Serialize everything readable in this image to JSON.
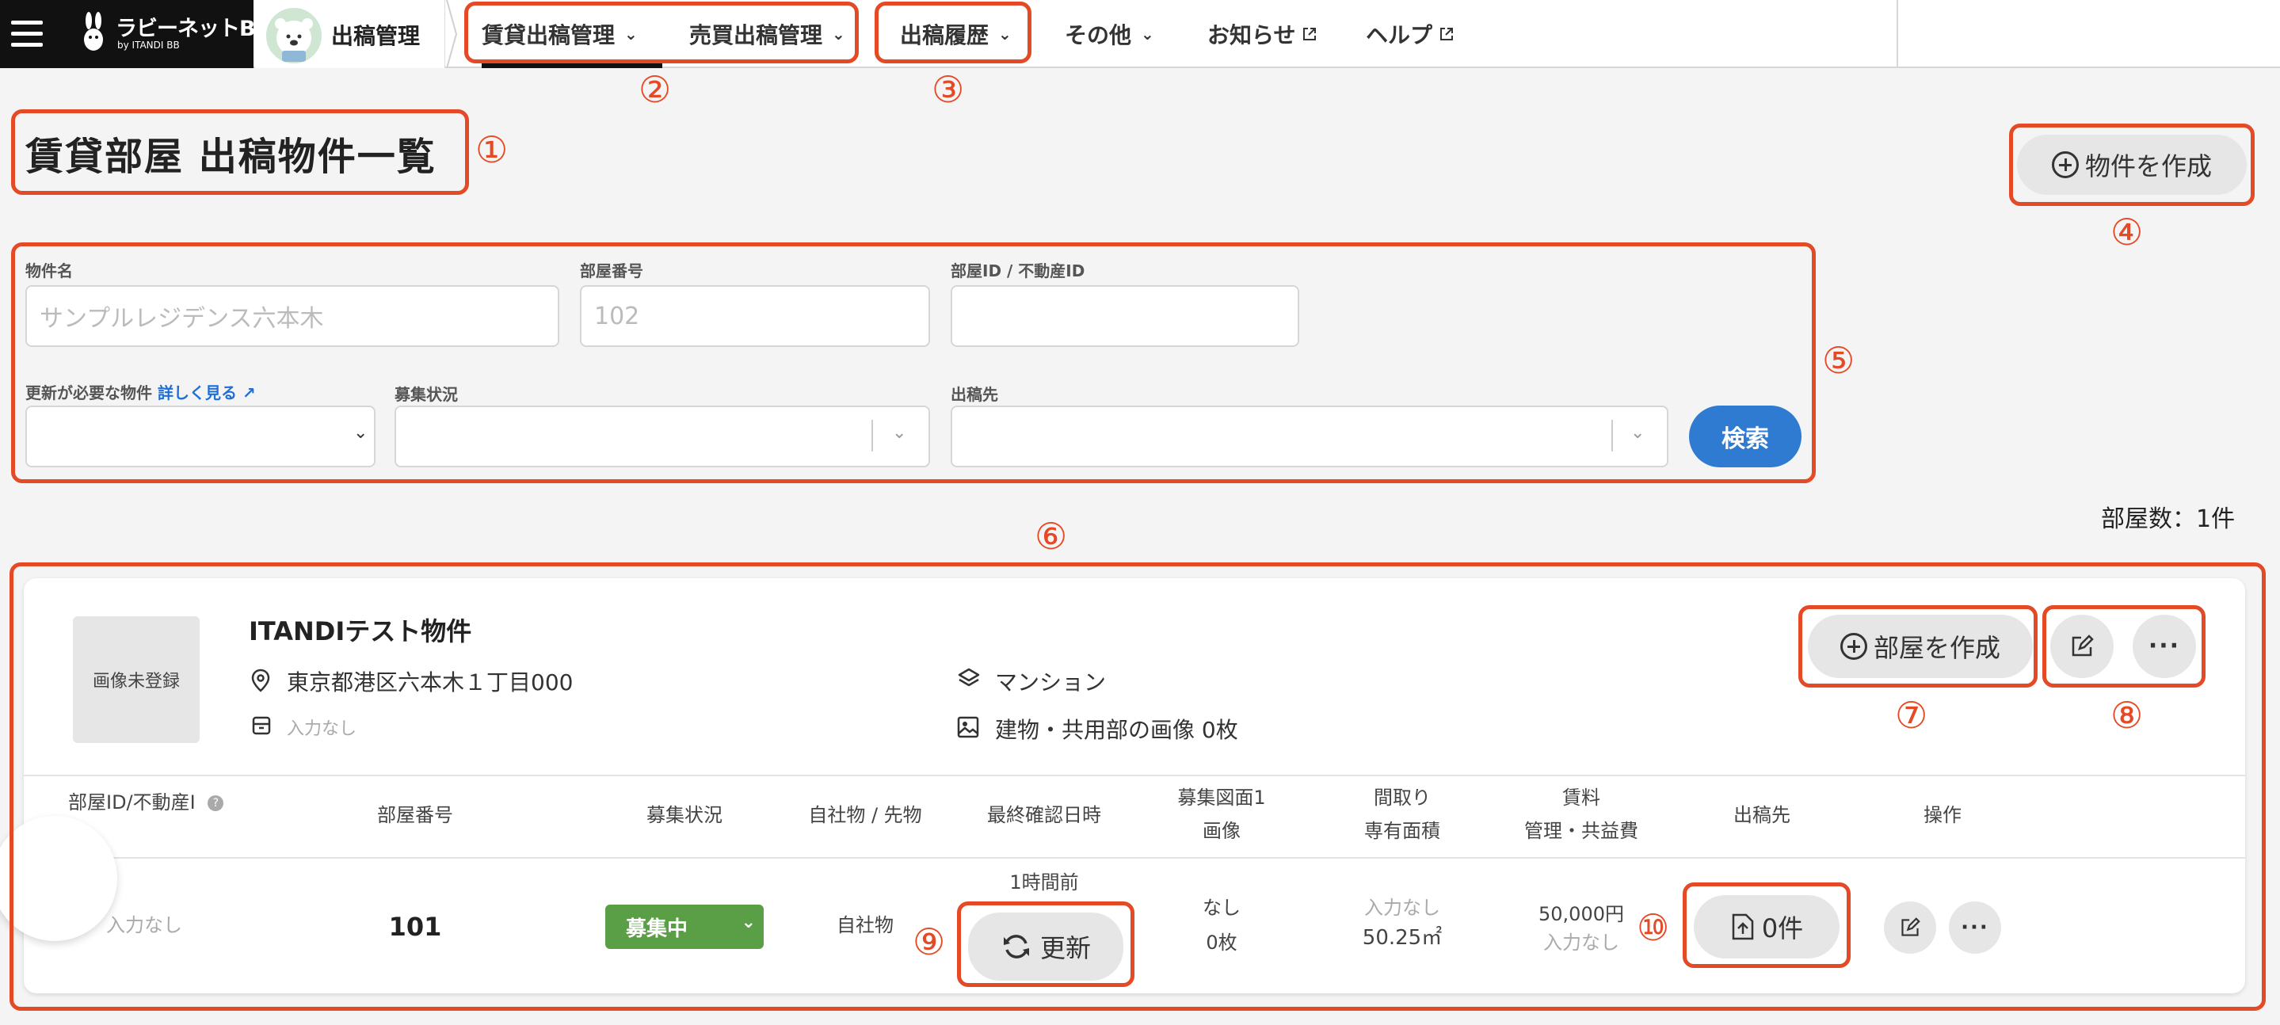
{
  "nav": {
    "logo_title": "ラビーネットBB",
    "logo_sub": "by ITANDI BB",
    "app_name": "出稿管理",
    "items": [
      {
        "label": "賃貸出稿管理"
      },
      {
        "label": "売買出稿管理"
      },
      {
        "label": "出稿履歴"
      },
      {
        "label": "その他"
      },
      {
        "label": "お知らせ"
      },
      {
        "label": "ヘルプ"
      }
    ]
  },
  "annotations": [
    "①",
    "②",
    "③",
    "④",
    "⑤",
    "⑥",
    "⑦",
    "⑧",
    "⑨",
    "⑩"
  ],
  "page": {
    "title": "賃貸部屋 出稿物件一覧",
    "create_property_label": "物件を作成",
    "room_count": "部屋数：1件"
  },
  "search": {
    "property_name_label": "物件名",
    "property_name_placeholder": "サンプルレジデンス六本木",
    "room_number_label": "部屋番号",
    "room_number_placeholder": "102",
    "room_id_label": "部屋ID / 不動産ID",
    "room_id_value": "",
    "needs_update_label": "更新が必要な物件",
    "details_link": "詳しく見る",
    "recruit_status_label": "募集状況",
    "publish_dest_label": "出稿先",
    "search_button": "検索"
  },
  "property": {
    "image_placeholder": "画像未登録",
    "name": "ITANDIテスト物件",
    "address": "東京都港区六本木１丁目000",
    "extra_info": "入力なし",
    "type": "マンション",
    "image_count": "建物・共用部の画像 0枚",
    "create_room_label": "部屋を作成"
  },
  "table": {
    "headers": {
      "room_id": "部屋ID/不動産I",
      "room_number": "部屋番号",
      "recruit_status": "募集状況",
      "ownership": "自社物 / 先物",
      "last_confirmed": "最終確認日時",
      "floor_plan_line1": "募集図面1",
      "floor_plan_line2": "画像",
      "layout_line1": "間取り",
      "layout_line2": "専有面積",
      "rent_line1": "賃料",
      "rent_line2": "管理・共益費",
      "publish_dest": "出稿先",
      "actions": "操作"
    },
    "rows": [
      {
        "room_id": "入力なし",
        "room_number": "101",
        "status": "募集中",
        "ownership": "自社物",
        "last_confirmed_ago": "1時間前",
        "update_button": "更新",
        "floor_plan": "なし",
        "images": "0枚",
        "layout": "入力なし",
        "area": "50.25㎡",
        "rent": "50,000円",
        "management_fee": "入力なし",
        "publish_count": "0件"
      }
    ]
  },
  "colors": {
    "annotation": "#e34a25",
    "primary": "#2f7bd1",
    "status_green": "#5a9f45",
    "dark": "#111111"
  },
  "icons": [
    "menu-icon",
    "rabbit-logo-icon",
    "chevron-down-icon",
    "external-link-icon",
    "plus-circle-icon",
    "location-pin-icon",
    "archive-icon",
    "layers-icon",
    "image-icon",
    "info-icon",
    "refresh-icon",
    "upload-file-icon",
    "edit-icon",
    "more-dots-icon"
  ]
}
